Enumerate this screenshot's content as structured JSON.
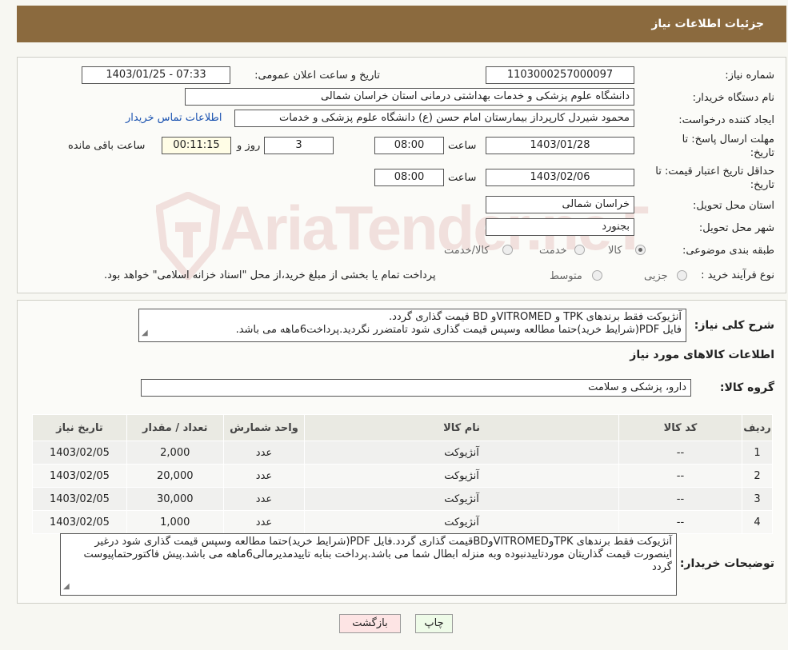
{
  "header": {
    "title": "جزئيات اطلاعات نياز"
  },
  "info": {
    "need_number_label": "شماره نیاز:",
    "need_number": "1103000257000097",
    "announce_label": "تاریخ و ساعت اعلان عمومی:",
    "announce_value": "1403/01/25 - 07:33",
    "buyer_org_label": "نام دستگاه خریدار:",
    "buyer_org": "دانشگاه علوم پزشکی و خدمات بهداشتی درمانی استان خراسان شمالی",
    "creator_label": "ایجاد کننده درخواست:",
    "creator": "محمود شیردل کارپرداز بیمارستان امام حسن (ع) دانشگاه علوم پزشکی و خدمات",
    "contact_link": "اطلاعات تماس خریدار",
    "deadline_label_1": "مهلت ارسال پاسخ: تا",
    "deadline_label_2": "تاریخ:",
    "deadline_date": "1403/01/28",
    "time_label": "ساعت",
    "deadline_time": "08:00",
    "days_value": "3",
    "days_label": "روز و",
    "remaining_value": "00:11:15",
    "remaining_label": "ساعت باقی مانده",
    "validity_label_1": "حداقل تاریخ اعتبار قیمت: تا",
    "validity_label_2": "تاریخ:",
    "validity_date": "1403/02/06",
    "validity_time": "08:00",
    "province_label": "استان محل تحویل:",
    "province": "خراسان شمالی",
    "city_label": "شهر محل تحویل:",
    "city": "بجنورد",
    "category_label": "طبقه بندی موضوعی:",
    "category_options": [
      "کالا",
      "خدمت",
      "کالا/خدمت"
    ],
    "process_label": "نوع فرآیند خرید :",
    "process_options": [
      "جزیی",
      "متوسط"
    ],
    "process_note": "پرداخت تمام یا بخشی از مبلغ خرید،از محل \"اسناد خزانه اسلامی\" خواهد بود."
  },
  "watermark": {
    "text": "AriaTender.neT"
  },
  "description": {
    "label": "شرح کلی نیاز:",
    "line1": "آنژیوکت فقط برندهای TPK و  VITROMEDو BD قیمت گذاری گردد.",
    "line2": "فایل PDF(شرایط خرید)حتما مطالعه وسپس قیمت گذاری شود تامتضرر نگردید.پرداخت6ماهه می باشد."
  },
  "goods": {
    "section_title": "اطلاعات کالاهای مورد نیاز",
    "group_label": "گروه کالا:",
    "group_value": "دارو، پزشکی و سلامت",
    "columns": [
      "ردیف",
      "کد کالا",
      "نام کالا",
      "واحد شمارش",
      "تعداد / مقدار",
      "تاریخ نیاز"
    ],
    "rows": [
      [
        "1",
        "--",
        "آنژیوکت",
        "عدد",
        "2,000",
        "1403/02/05"
      ],
      [
        "2",
        "--",
        "آنژیوکت",
        "عدد",
        "20,000",
        "1403/02/05"
      ],
      [
        "3",
        "--",
        "آنژیوکت",
        "عدد",
        "30,000",
        "1403/02/05"
      ],
      [
        "4",
        "--",
        "آنژیوکت",
        "عدد",
        "1,000",
        "1403/02/05"
      ]
    ]
  },
  "buyer_notes": {
    "label": "توضیحات خریدار:",
    "text": "آنژیوکت فقط برندهای TPKوVITROMEDوBDقیمت گذاری گردد.فایل PDF(شرایط خرید)حتما مطالعه وسپس قیمت گذاری شود درغیر اینصورت قیمت گذاریتان موردتاییدنبوده وبه منزله ابطال شما می باشد.پرداخت بنابه تاییدمدیرمالی6ماهه می باشد.پیش فاکتورحتماپیوست گردد"
  },
  "buttons": {
    "print": "چاپ",
    "back": "بازگشت"
  }
}
